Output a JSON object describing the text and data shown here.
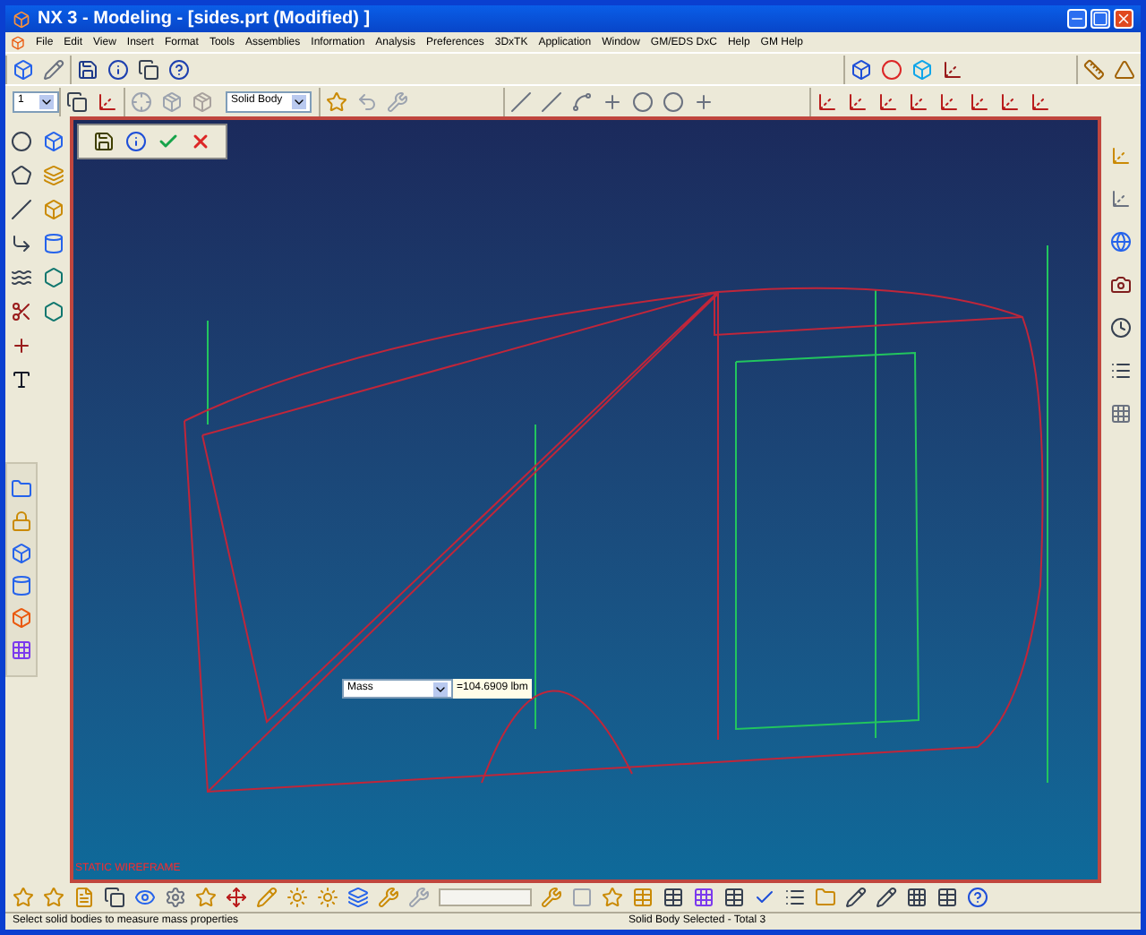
{
  "window": {
    "title": "NX 3 - Modeling - [sides.prt (Modified) ]"
  },
  "menu": [
    "File",
    "Edit",
    "View",
    "Insert",
    "Format",
    "Tools",
    "Assemblies",
    "Information",
    "Analysis",
    "Preferences",
    "3DxTK",
    "Application",
    "Window",
    "GM/EDS DxC",
    "Help",
    "GM Help"
  ],
  "toolbar": {
    "layer_dropdown": "1",
    "filter_dropdown": "Solid Body"
  },
  "viewport": {
    "label": "STATIC WIREFRAME",
    "measure": {
      "field": "Mass",
      "value": "=104.6909 lbm"
    }
  },
  "status_bar": {
    "prompt": "Select solid bodies to measure mass properties",
    "selection": "Solid Body Selected - Total 3"
  }
}
